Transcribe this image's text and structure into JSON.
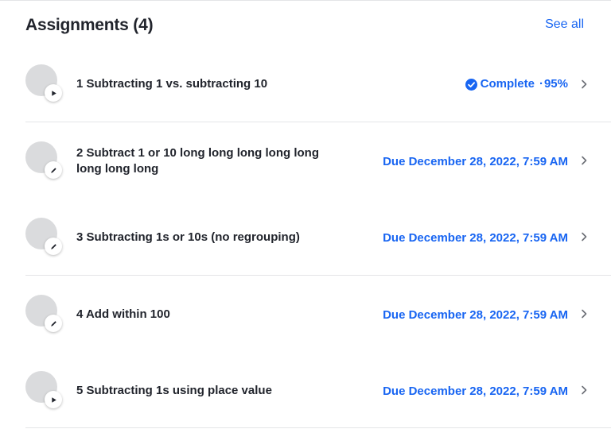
{
  "header": {
    "title": "Assignments (4)",
    "see_all": "See all"
  },
  "assignments": [
    {
      "title": "1 Subtracting 1 vs. subtracting 10",
      "icon": "play-icon",
      "status": "Complete",
      "separator": "·",
      "score": "95%",
      "status_icon": "check-circle-icon"
    },
    {
      "title": "2 Subtract 1 or 10 long long long long long long long long",
      "icon": "pencil-icon",
      "status": "Due December 28, 2022, 7:59 AM"
    },
    {
      "title": "3 Subtracting 1s or 10s (no regrouping)",
      "icon": "pencil-icon",
      "status": "Due December 28, 2022, 7:59 AM"
    },
    {
      "title": "4 Add within 100",
      "icon": "pencil-icon",
      "status": "Due December 28, 2022, 7:59 AM"
    },
    {
      "title": "5 Subtracting 1s using place value",
      "icon": "play-icon",
      "status": "Due December 28, 2022, 7:59 AM"
    }
  ],
  "colors": {
    "accent": "#1865f2",
    "text": "#21242c",
    "divider": "#e4e5e7",
    "thumbnail": "#dadbdd"
  }
}
